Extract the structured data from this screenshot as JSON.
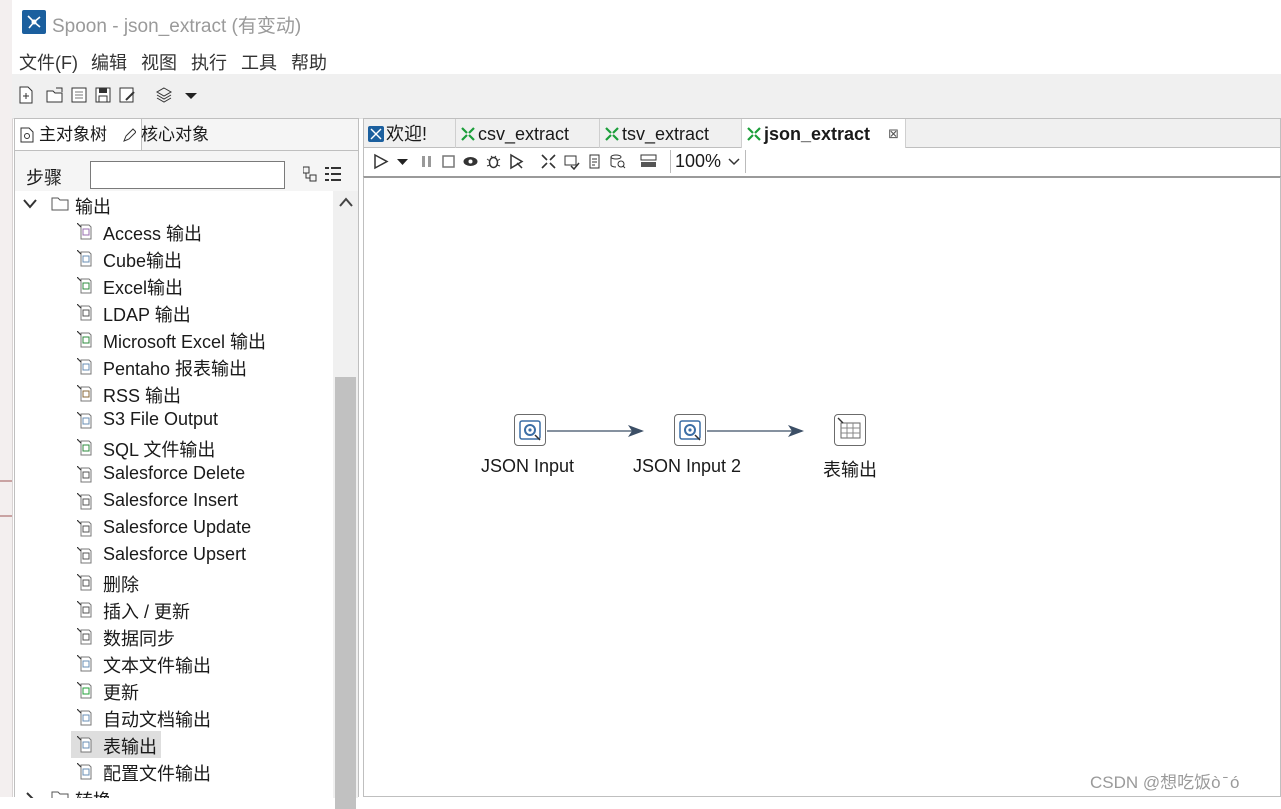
{
  "window": {
    "title": "Spoon - json_extract (有变动)"
  },
  "menubar": [
    "文件(F)",
    "编辑",
    "视图",
    "执行",
    "工具",
    "帮助"
  ],
  "left_tabs": [
    {
      "label": "主对象树",
      "icon": "document-icon"
    },
    {
      "label": "核心对象",
      "icon": "pencil-icon"
    }
  ],
  "steps_search": {
    "label": "步骤",
    "value": ""
  },
  "tree": {
    "folder_open": {
      "label": "输出",
      "icon": "folder-icon"
    },
    "items": [
      {
        "label": "Access 输出",
        "icon": "access-output-icon"
      },
      {
        "label": "Cube输出",
        "icon": "cube-output-icon"
      },
      {
        "label": "Excel输出",
        "icon": "excel-output-icon"
      },
      {
        "label": "LDAP 输出",
        "icon": "ldap-output-icon"
      },
      {
        "label": "Microsoft Excel 输出",
        "icon": "ms-excel-output-icon"
      },
      {
        "label": "Pentaho 报表输出",
        "icon": "report-output-icon"
      },
      {
        "label": "RSS 输出",
        "icon": "rss-output-icon"
      },
      {
        "label": "S3 File Output",
        "icon": "s3-output-icon"
      },
      {
        "label": "SQL 文件输出",
        "icon": "sql-output-icon"
      },
      {
        "label": "Salesforce Delete",
        "icon": "salesforce-delete-icon"
      },
      {
        "label": "Salesforce Insert",
        "icon": "salesforce-insert-icon"
      },
      {
        "label": "Salesforce Update",
        "icon": "salesforce-update-icon"
      },
      {
        "label": "Salesforce Upsert",
        "icon": "salesforce-upsert-icon"
      },
      {
        "label": "删除",
        "icon": "delete-icon"
      },
      {
        "label": "插入 / 更新",
        "icon": "insert-update-icon"
      },
      {
        "label": "数据同步",
        "icon": "sync-icon"
      },
      {
        "label": "文本文件输出",
        "icon": "text-output-icon"
      },
      {
        "label": "更新",
        "icon": "update-icon"
      },
      {
        "label": "自动文档输出",
        "icon": "autodoc-icon"
      },
      {
        "label": "表输出",
        "icon": "table-output-icon",
        "selected": true
      },
      {
        "label": "配置文件输出",
        "icon": "properties-output-icon"
      }
    ],
    "folder_closed": {
      "label": "转换",
      "icon": "folder-icon"
    }
  },
  "doc_tabs": [
    {
      "label": "欢迎!",
      "icon": "spoon-icon"
    },
    {
      "label": "csv_extract",
      "icon": "transformation-icon"
    },
    {
      "label": "tsv_extract",
      "icon": "transformation-icon"
    },
    {
      "label": "json_extract",
      "icon": "transformation-icon",
      "active": true,
      "close": "⊠"
    }
  ],
  "zoom": "100%",
  "canvas": {
    "steps": [
      {
        "label": "JSON Input",
        "icon": "json-input-icon"
      },
      {
        "label": "JSON Input 2",
        "icon": "json-input-icon"
      },
      {
        "label": "表输出",
        "icon": "table-output-icon"
      }
    ]
  },
  "watermark": "CSDN @想吃饭ò ̄ ó"
}
